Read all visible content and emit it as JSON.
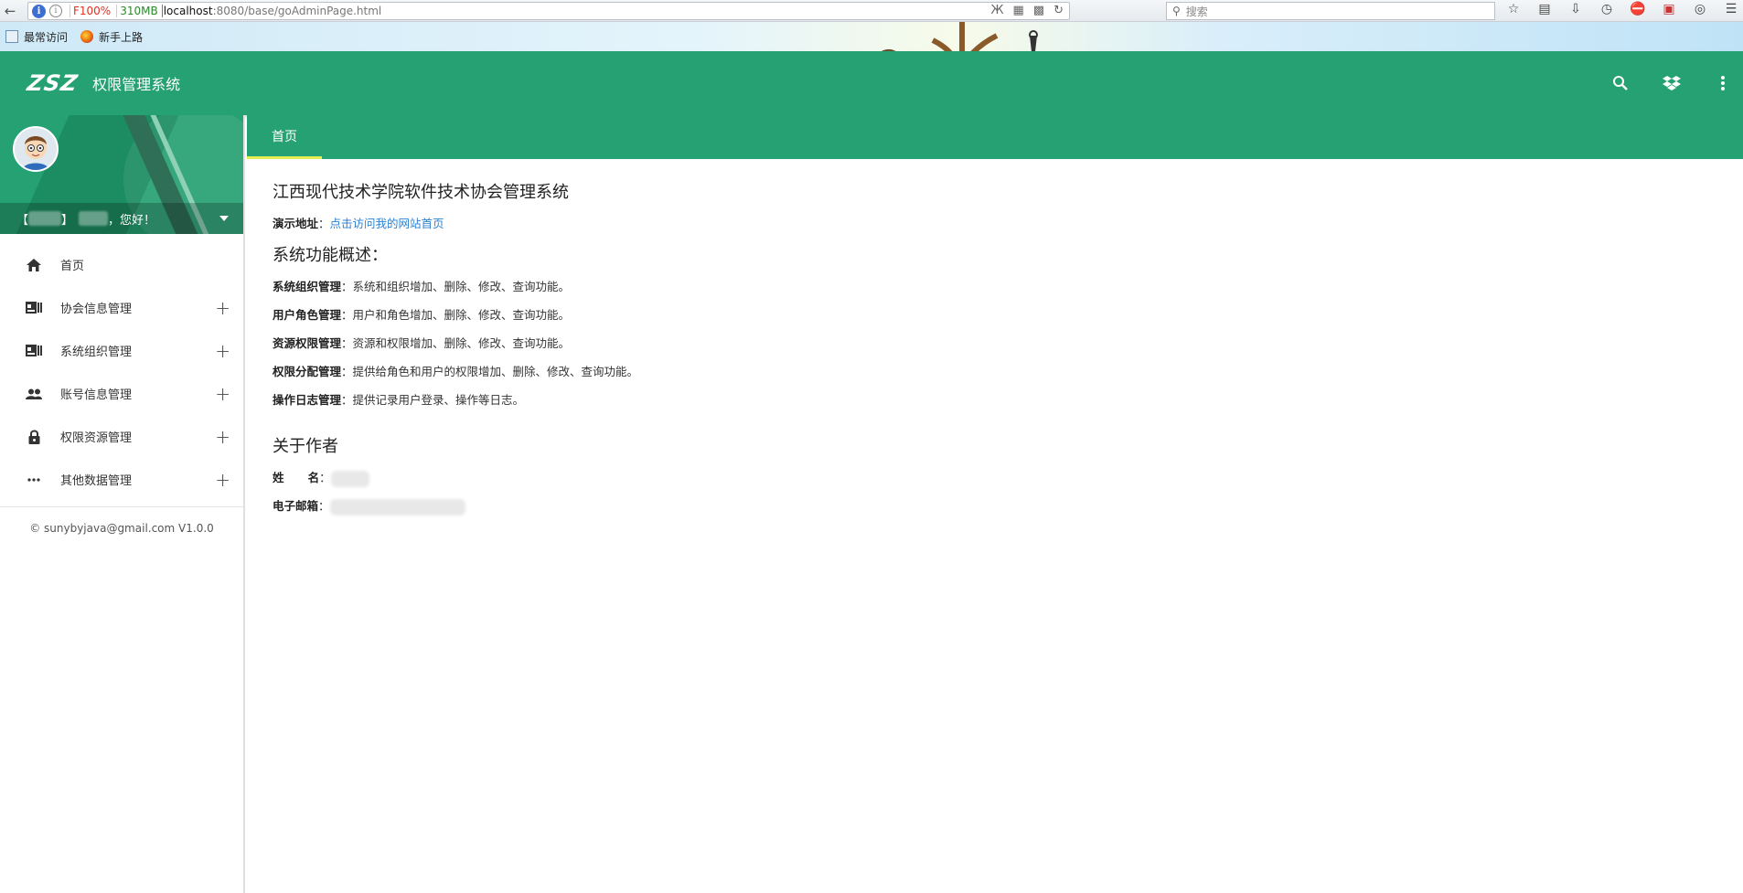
{
  "browser": {
    "zoom": "F100%",
    "memory": "310MB",
    "url_host": "localhost",
    "url_path": ":8080/base/goAdminPage.html",
    "search_placeholder": "搜索",
    "bookmarks": [
      "最常访问",
      "新手上路"
    ]
  },
  "header": {
    "logo": "ZSZ",
    "title": "权限管理系统"
  },
  "sidebar": {
    "greeting": "，您好！",
    "user_prefix": "【",
    "user_suffix": "】",
    "items": [
      {
        "label": "首页",
        "icon": "home-icon",
        "expandable": false
      },
      {
        "label": "协会信息管理",
        "icon": "id-card-icon",
        "expandable": true
      },
      {
        "label": "系统组织管理",
        "icon": "id-card-icon",
        "expandable": true
      },
      {
        "label": "账号信息管理",
        "icon": "people-icon",
        "expandable": true
      },
      {
        "label": "权限资源管理",
        "icon": "lock-icon",
        "expandable": true
      },
      {
        "label": "其他数据管理",
        "icon": "more-horiz-icon",
        "expandable": true
      }
    ],
    "copyright": "© sunybyjava@gmail.com V1.0.0"
  },
  "tabs": [
    {
      "label": "首页",
      "active": true
    }
  ],
  "content": {
    "title": "江西现代技术学院软件技术协会管理系统",
    "demo_label": "演示地址",
    "demo_link": "点击访问我的网站首页",
    "overview_title": "系统功能概述：",
    "features": [
      {
        "name": "系统组织管理",
        "desc": "系统和组织增加、删除、修改、查询功能。"
      },
      {
        "name": "用户角色管理",
        "desc": "用户和角色增加、删除、修改、查询功能。"
      },
      {
        "name": "资源权限管理",
        "desc": "资源和权限增加、删除、修改、查询功能。"
      },
      {
        "name": "权限分配管理",
        "desc": "提供给角色和用户的权限增加、删除、修改、查询功能。"
      },
      {
        "name": "操作日志管理",
        "desc": "提供记录用户登录、操作等日志。"
      }
    ],
    "author_title": "关于作者",
    "name_label": "姓      名",
    "email_label": "电子邮箱"
  },
  "colors": {
    "primary": "#26a173",
    "tab_indicator": "#e6ee53",
    "link": "#2d82d1"
  }
}
